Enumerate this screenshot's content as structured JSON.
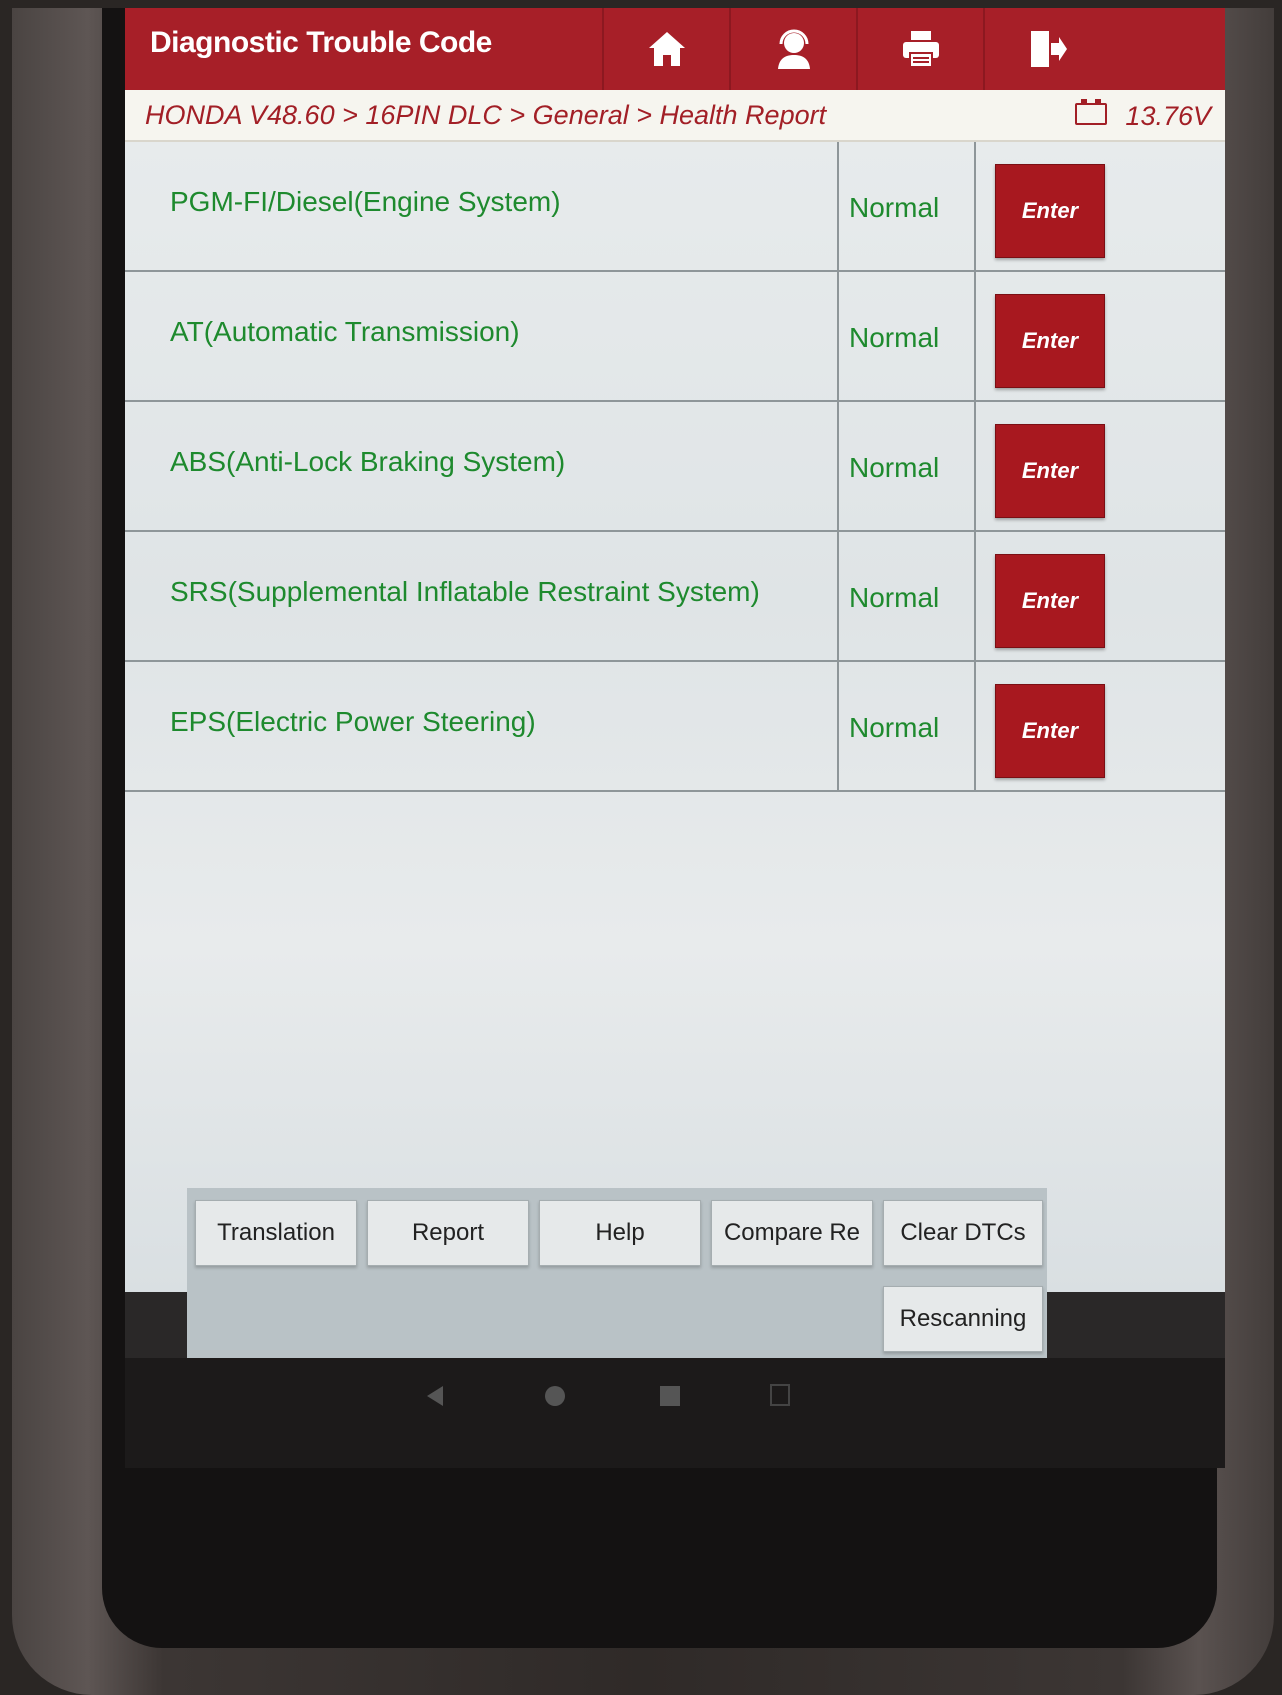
{
  "header": {
    "title": "Diagnostic Trouble Code"
  },
  "breadcrumb": {
    "path": "HONDA V48.60 > 16PIN DLC > General > Health Report",
    "voltage": "13.76V"
  },
  "systems": [
    {
      "name": "PGM-FI/Diesel(Engine System)",
      "status": "Normal",
      "action": "Enter"
    },
    {
      "name": "AT(Automatic Transmission)",
      "status": "Normal",
      "action": "Enter"
    },
    {
      "name": "ABS(Anti-Lock Braking System)",
      "status": "Normal",
      "action": "Enter"
    },
    {
      "name": "SRS(Supplemental Inflatable Restraint System)",
      "status": "Normal",
      "action": "Enter"
    },
    {
      "name": "EPS(Electric Power Steering)",
      "status": "Normal",
      "action": "Enter"
    }
  ],
  "buttons": {
    "translation": "Translation",
    "report": "Report",
    "help": "Help",
    "compare": "Compare Re",
    "clear_dtcs": "Clear DTCs",
    "rescanning": "Rescanning"
  },
  "colors": {
    "brand": "#a71f28",
    "status_text": "#1e8a2e"
  }
}
